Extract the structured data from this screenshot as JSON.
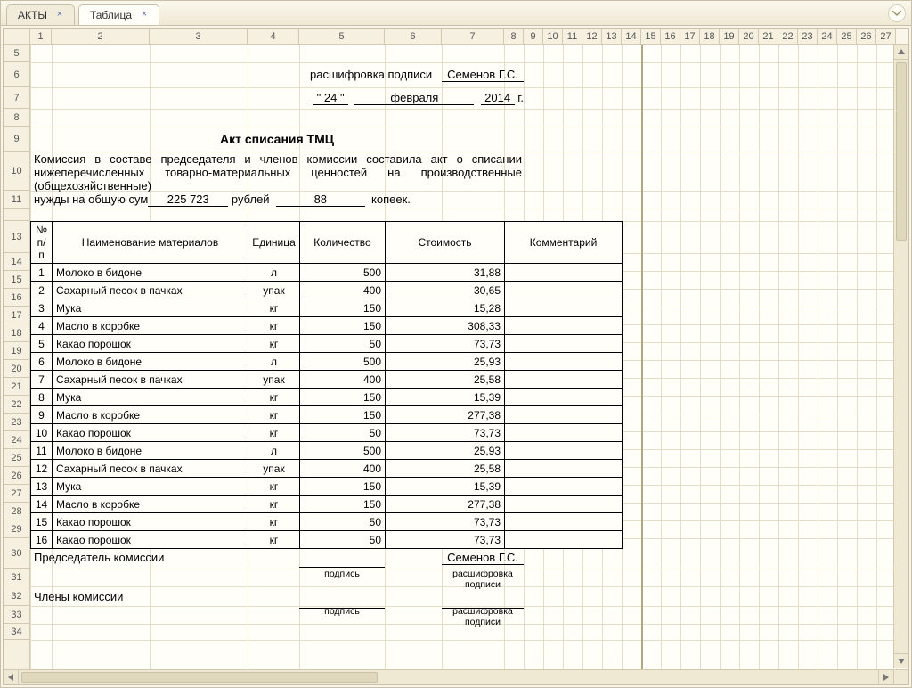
{
  "tabs": [
    {
      "label": "АКТЫ",
      "active": false
    },
    {
      "label": "Таблица",
      "active": true
    }
  ],
  "columns": {
    "widths": [
      24,
      110,
      110,
      58,
      96,
      64,
      70,
      22,
      22,
      22,
      22,
      22,
      22,
      22,
      22,
      22,
      22,
      22,
      22,
      22,
      22,
      22,
      22,
      22,
      22,
      22,
      22
    ],
    "labels": [
      "1",
      "2",
      "3",
      "4",
      "5",
      "6",
      "7",
      "8",
      "9",
      "10",
      "11",
      "12",
      "13",
      "14",
      "15",
      "16",
      "17",
      "18",
      "19",
      "20",
      "21",
      "22",
      "23",
      "24",
      "25",
      "26",
      "27"
    ]
  },
  "rows": {
    "visible": [
      "5",
      "6",
      "7",
      "8",
      "9",
      "10",
      "11",
      "",
      "13",
      "14",
      "15",
      "16",
      "17",
      "18",
      "19",
      "20",
      "21",
      "22",
      "23",
      "24",
      "25",
      "26",
      "27",
      "28",
      "29",
      "30",
      "31",
      "32",
      "33",
      "34"
    ],
    "heights": {
      "5": 20,
      "6": 28,
      "7": 24,
      "8": 20,
      "9": 28,
      "10": 44,
      "11": 20,
      "blank": 14,
      "13": 36,
      "row": 20,
      "30": 34,
      "31": 20,
      "32": 22,
      "33": 20,
      "34": 18
    }
  },
  "doc": {
    "sig_decode_label": "расшифровка подписи",
    "sig_name": "Семенов Г.С.",
    "date_q1": "\" 24 \"",
    "date_month": "февраля",
    "date_year": "2014",
    "date_g": "г.",
    "title": "Акт списания ТМЦ",
    "paragraph": "Комиссия в составе председателя и членов комиссии составила акт о списании нижеперечисленных товарно-материальных ценностей на производственные (общехозяйственные)",
    "need_prefix": "нужды  на общую сум",
    "sum_rub": "225 723",
    "rub_label": "рублей",
    "sum_kop": "88",
    "kop_label": "копеек.",
    "table": {
      "headers": {
        "num": "№ п/п",
        "name": "Наименование материалов",
        "unit": "Единица",
        "qty": "Количество",
        "cost": "Стоимость",
        "comment": "Комментарий"
      },
      "rows": [
        {
          "n": "1",
          "name": "Молоко в бидоне",
          "unit": "л",
          "qty": "500",
          "cost": "31,88",
          "comment": ""
        },
        {
          "n": "2",
          "name": "Сахарный песок в пачках",
          "unit": "упак",
          "qty": "400",
          "cost": "30,65",
          "comment": ""
        },
        {
          "n": "3",
          "name": "Мука",
          "unit": "кг",
          "qty": "150",
          "cost": "15,28",
          "comment": ""
        },
        {
          "n": "4",
          "name": "Масло в коробке",
          "unit": "кг",
          "qty": "150",
          "cost": "308,33",
          "comment": ""
        },
        {
          "n": "5",
          "name": "Какао порошок",
          "unit": "кг",
          "qty": "50",
          "cost": "73,73",
          "comment": ""
        },
        {
          "n": "6",
          "name": "Молоко в бидоне",
          "unit": "л",
          "qty": "500",
          "cost": "25,93",
          "comment": ""
        },
        {
          "n": "7",
          "name": "Сахарный песок в пачках",
          "unit": "упак",
          "qty": "400",
          "cost": "25,58",
          "comment": ""
        },
        {
          "n": "8",
          "name": "Мука",
          "unit": "кг",
          "qty": "150",
          "cost": "15,39",
          "comment": ""
        },
        {
          "n": "9",
          "name": "Масло в коробке",
          "unit": "кг",
          "qty": "150",
          "cost": "277,38",
          "comment": ""
        },
        {
          "n": "10",
          "name": "Какао порошок",
          "unit": "кг",
          "qty": "50",
          "cost": "73,73",
          "comment": ""
        },
        {
          "n": "11",
          "name": "Молоко в бидоне",
          "unit": "л",
          "qty": "500",
          "cost": "25,93",
          "comment": ""
        },
        {
          "n": "12",
          "name": "Сахарный песок в пачках",
          "unit": "упак",
          "qty": "400",
          "cost": "25,58",
          "comment": ""
        },
        {
          "n": "13",
          "name": "Мука",
          "unit": "кг",
          "qty": "150",
          "cost": "15,39",
          "comment": ""
        },
        {
          "n": "14",
          "name": "Масло в коробке",
          "unit": "кг",
          "qty": "150",
          "cost": "277,38",
          "comment": ""
        },
        {
          "n": "15",
          "name": "Какао порошок",
          "unit": "кг",
          "qty": "50",
          "cost": "73,73",
          "comment": ""
        },
        {
          "n": "16",
          "name": "Какао порошок",
          "unit": "кг",
          "qty": "50",
          "cost": "73,73",
          "comment": ""
        }
      ]
    },
    "chairman_label": "Председатель комиссии",
    "members_label": "Члены комиссии",
    "sig_small": "подпись",
    "decode_small": "расшифровка подписи",
    "chairman_name": "Семенов Г.С."
  }
}
